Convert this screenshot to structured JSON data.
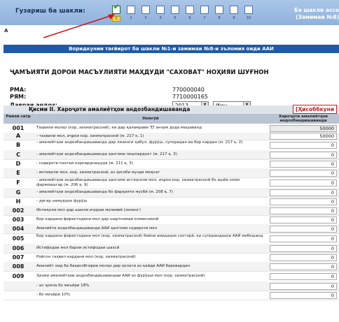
{
  "nav": {
    "label": "Гузариш ба шакли:",
    "steps": [
      "1",
      "2",
      "3",
      "4",
      "5",
      "6",
      "7",
      "8",
      "9",
      "10"
    ],
    "active_index": 0,
    "right_lines": [
      "Ба шакли ассо",
      "(Замимаи №8)"
    ]
  },
  "section_letter": "A",
  "banner": "Воридкунии тағйирот ба шакли №1-и замимаи №8-и эъломия оиди ААИ",
  "org_name": "ҶАМЪИЯТИ ДОРОИ МАСЪУЛИЯТИ МАҲДУДИ \"САХОВАТ\" НОҲИЯИ ШУҒНОН",
  "fields": {
    "rma_label": "РМА:",
    "rma_value": "770000040",
    "rym_label": "РЯМ:",
    "rym_value": "7710000165",
    "period_label": "Давраи андоз:",
    "year": "2013",
    "month": "Июн"
  },
  "section": {
    "title": "Қисми II. Хароҷоти амалиётҳои андозбандишаванда",
    "calc_link": "[Ҳисоббкуни"
  },
  "table": {
    "headers": {
      "code": "Рамзи сатр",
      "name": "Номгӯй",
      "amount": "Хароҷоти амалиётҳои андозбандишаванда"
    },
    "rows": [
      {
        "code": "001",
        "text": "Таҳвили молҳо (кор, хизматрасонӣ), ки дар қаламрави ҶТ анҷом дода мешаванд",
        "amount": "50000",
        "filled": true
      },
      {
        "code": "A",
        "text": "- таҳвили мол, иҷрои кор, хизматрасонӣ (м. 217 қ. 1)",
        "amount": "50000",
        "filled": false
      },
      {
        "code": "B",
        "text": "- амалиётҳои андозбандишаванда дар лизинги қабул, фурӯш, супоридан ва бор кардан (м. 217 қ. 2)",
        "amount": "0",
        "filled": false
      },
      {
        "code": "C",
        "text": "- амалиётҳои андозбандишаванда ҳангоми пешпардохт (м. 217 қ. 3)",
        "amount": "0",
        "filled": false
      },
      {
        "code": "D",
        "text": "- содироти пахтаи коркарднашуда (м. 211 қ. 3)",
        "amount": "0",
        "filled": false
      },
      {
        "code": "E",
        "text": "- интиқоли мол, кор, хизматрасонӣ, аз ҳисоби музди меҳнат",
        "amount": "0",
        "filled": false
      },
      {
        "code": "F",
        "text": "- амалиётҳои андозбандишаванда ҳангоми истеҳсоли мол, иҷрои кор, хизматрасонӣ бо ашёи хоми фармоишгар (м. 206 қ. 9)",
        "amount": "0",
        "filled": false
      },
      {
        "code": "G",
        "text": "- амалиётҳои андозбандишаванда бо фарқияти мусбӣ (м. 208 қ. 7)",
        "amount": "0",
        "filled": false
      },
      {
        "code": "H",
        "text": "- дигар намудҳои фурӯш",
        "amount": "0",
        "filled": false
      },
      {
        "code": "002",
        "text": "Интиқоли мол дар шакли иҷораи молиявӣ (лизинг)",
        "amount": "0",
        "filled": false
      },
      {
        "code": "003",
        "text": "Бор кардани фиристодани мол дар шартномаи комиссионӣ",
        "amount": "0",
        "filled": false
      },
      {
        "code": "004",
        "text": "Амалиёти андозбандишаванда ААИ ҳангоми содироти мол",
        "amount": "0",
        "filled": false
      },
      {
        "code": "005",
        "text": "Бор кардани фиристодани мол (кор, хизматрасонӣ) бейни воидаҳои сохторӣ, ки супорандаҳои ААИ мебошанд",
        "amount": "0",
        "filled": false
      },
      {
        "code": "006",
        "text": "Истифодаи мол барои истифодаи шахсӣ",
        "amount": "0",
        "filled": false
      },
      {
        "code": "007",
        "text": "Ройгон таҳвил кардани мол (кор, хизматрасонӣ)",
        "amount": "0",
        "filled": false
      },
      {
        "code": "008",
        "text": "Амалиёт оид ба баҳисобгирии молҳо дар ҳолати аз қайди ААИ баровардан",
        "amount": "0",
        "filled": false
      },
      {
        "code": "009",
        "text": "Ҳаҷми амалиётҳои андозбандишавандаи ААИ аз фурӯши мол (кор, хизматрасонӣ)",
        "amount": "0",
        "filled": false
      },
      {
        "code": "",
        "text": "- аз ҷумла бо меъёри 18%",
        "amount": "0",
        "filled": false
      },
      {
        "code": "",
        "text": "- бо меъёри 10%",
        "amount": "0",
        "filled": false
      }
    ]
  }
}
